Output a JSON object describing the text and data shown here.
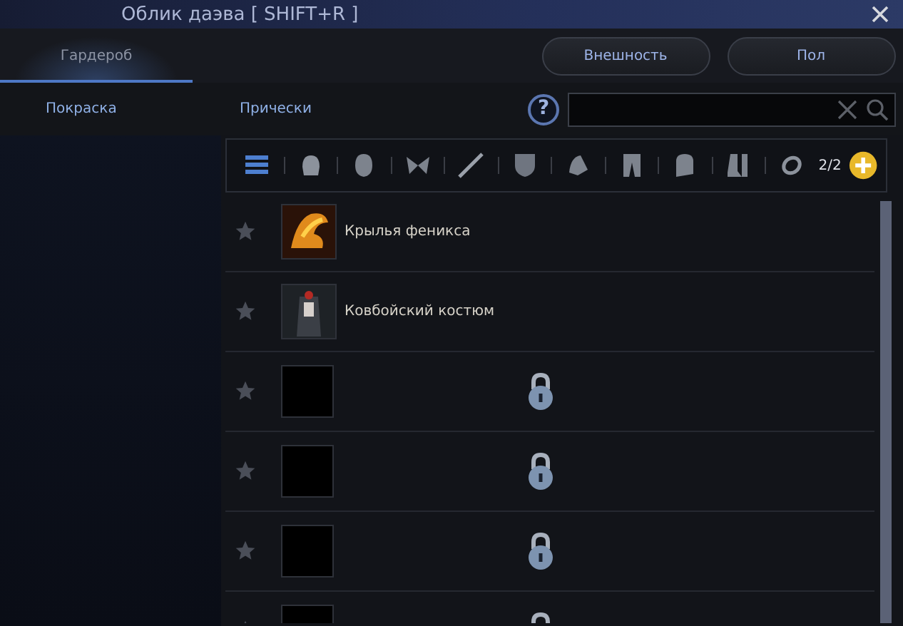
{
  "window": {
    "title": "Облик даэва [ SHIFT+R ]"
  },
  "tabs": [
    {
      "label": "Гардероб",
      "selected": true
    }
  ],
  "header_buttons": [
    "Внешность",
    "Пол"
  ],
  "sub_tabs": [
    {
      "label": "Покраска",
      "selected": false
    },
    {
      "label": "Прически",
      "selected": false
    }
  ],
  "help": "?",
  "filter_bar": {
    "count": "2/2"
  },
  "items": [
    {
      "kind": "item",
      "name": "Крылья феникса",
      "thumbnail": {
        "kind": "wings"
      }
    },
    {
      "kind": "item",
      "name": "Ковбойский костюм",
      "thumbnail": {
        "kind": "costume"
      }
    },
    {
      "kind": "locked"
    },
    {
      "kind": "locked"
    },
    {
      "kind": "locked"
    },
    {
      "kind": "locked"
    }
  ]
}
